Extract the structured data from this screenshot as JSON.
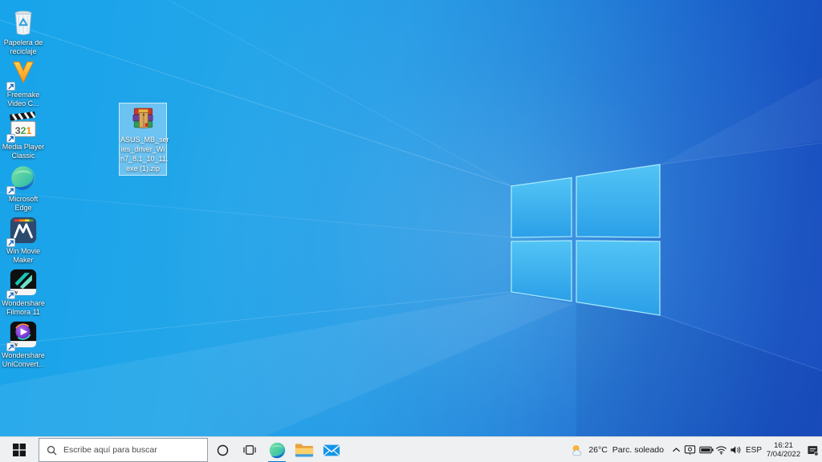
{
  "colors": {
    "accent_blue": "#0078d4",
    "taskbar_bg": "#eef0f2",
    "wallpaper_left": "#17a4ea",
    "wallpaper_right": "#1b4fc0",
    "logo_fill_top": "#52c4f5",
    "logo_fill_bottom": "#2b9fe8",
    "logo_edge": "#b8f3fe",
    "selection_fill": "rgba(173,221,247,0.55)"
  },
  "desktop": {
    "icons": [
      {
        "id": "recycle-bin",
        "label": "Papelera de reciclaje",
        "shortcut": false
      },
      {
        "id": "freemake-video-converter",
        "label": "Freemake Video C...",
        "shortcut": true
      },
      {
        "id": "media-player-classic",
        "label": "Media Player Classic",
        "shortcut": true
      },
      {
        "id": "microsoft-edge",
        "label": "Microsoft Edge",
        "shortcut": true
      },
      {
        "id": "win-movie-maker",
        "label": "Win Movie Maker",
        "shortcut": true
      },
      {
        "id": "wondershare-filmora",
        "label": "Wondershare Filmora 11",
        "shortcut": true
      },
      {
        "id": "wondershare-uniconverter",
        "label": "Wondershare UniConvert...",
        "shortcut": true
      }
    ],
    "selected_file": {
      "id": "winrar-zip-archive",
      "icon": "winrar-archive-icon",
      "label_lines": [
        "ASUS_MB_ser",
        "ies_driver_Wi",
        "n7_8.1_10_11.",
        "exe (1).zip"
      ],
      "selected": true
    }
  },
  "taskbar": {
    "start": {
      "icon": "windows-logo-icon"
    },
    "search": {
      "icon": "search-icon",
      "placeholder": "Escribe aquí para buscar"
    },
    "buttons": [
      {
        "icon": "cortana-icon",
        "active": false
      },
      {
        "icon": "task-view-icon",
        "active": false
      },
      {
        "icon": "edge-icon",
        "active": true
      },
      {
        "icon": "file-explorer-icon",
        "active": false
      },
      {
        "icon": "mail-icon",
        "active": false
      }
    ],
    "tray": {
      "weather": {
        "icon": "partly-sunny-icon",
        "temperature": "26°C",
        "condition": "Parc. soleado"
      },
      "hidden_icons": {
        "icon": "chevron-up-icon"
      },
      "status_icons": [
        "display-icon",
        "battery-icon",
        "wifi-icon",
        "volume-icon"
      ],
      "language": "ESP",
      "clock": {
        "time": "16:21",
        "date": "7/04/2022"
      },
      "action_center": {
        "icon": "action-center-icon"
      }
    }
  }
}
